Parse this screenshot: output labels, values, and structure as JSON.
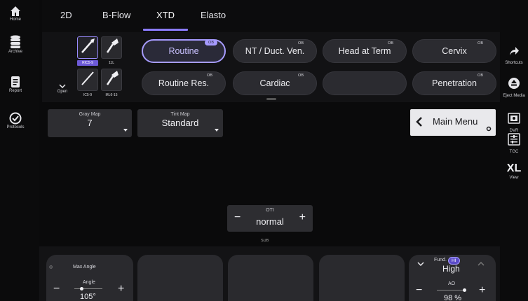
{
  "sidebar_left": {
    "items": [
      {
        "label": "Home",
        "icon": "home-icon"
      },
      {
        "label": "Archive",
        "icon": "database-icon"
      },
      {
        "label": "Report",
        "icon": "report-icon"
      },
      {
        "label": "Protocols",
        "icon": "check-circle-icon"
      }
    ]
  },
  "sidebar_right": {
    "items": [
      {
        "label": "Shortcuts",
        "icon": "arrow-share-icon"
      },
      {
        "label": "Eject Media",
        "icon": "eject-icon"
      },
      {
        "label": "DVR",
        "icon": "dvr-icon"
      },
      {
        "label": "TGC",
        "icon": "tgc-icon"
      },
      {
        "label": "View",
        "icon_text": "XL"
      }
    ]
  },
  "tabs": [
    {
      "label": "2D",
      "active": false
    },
    {
      "label": "B-Flow",
      "active": false
    },
    {
      "label": "XTD",
      "active": true
    },
    {
      "label": "Elasto",
      "active": false
    }
  ],
  "probes": [
    {
      "label": "RIC5-9",
      "selected": true
    },
    {
      "label": "11L",
      "selected": false
    },
    {
      "label": "IC5-9",
      "selected": false
    },
    {
      "label": "ML6-15",
      "selected": false
    }
  ],
  "open_label": "Open",
  "presets": [
    {
      "label": "Routine",
      "badge": "OB",
      "selected": true
    },
    {
      "label": "NT / Duct. Ven.",
      "badge": "OB",
      "selected": false
    },
    {
      "label": "Head at Term",
      "badge": "OB",
      "selected": false
    },
    {
      "label": "Cervix",
      "badge": "OB",
      "selected": false
    },
    {
      "label": "Routine Res.",
      "badge": "OB",
      "selected": false
    },
    {
      "label": "Cardiac",
      "badge": "OB",
      "selected": false
    },
    {
      "label": "",
      "badge": "",
      "selected": false
    },
    {
      "label": "Penetration",
      "badge": "OB",
      "selected": false
    }
  ],
  "gray_map": {
    "title": "Gray Map",
    "value": "7"
  },
  "tint_map": {
    "title": "Tint Map",
    "value": "Standard"
  },
  "main_menu": {
    "label": "Main Menu"
  },
  "oti": {
    "title": "OTI",
    "value": "normal",
    "minus": "−",
    "plus": "+"
  },
  "sub_label": "SUB",
  "bottom": {
    "max_angle": {
      "title": "Max Angle",
      "sub": "Angle",
      "value": "105°",
      "minus": "−",
      "plus": "+",
      "level": 0.25
    },
    "fund": {
      "title": "Fund.",
      "badge": "HI",
      "value": "High"
    },
    "ao": {
      "title": "AO",
      "value": "98 %",
      "minus": "−",
      "plus": "+",
      "level": 0.98
    }
  },
  "colors": {
    "accent": "#a69bff",
    "accent_dark": "#6d5ad8",
    "panel": "#2d2d31",
    "menu_bg": "#e9e9ec"
  }
}
